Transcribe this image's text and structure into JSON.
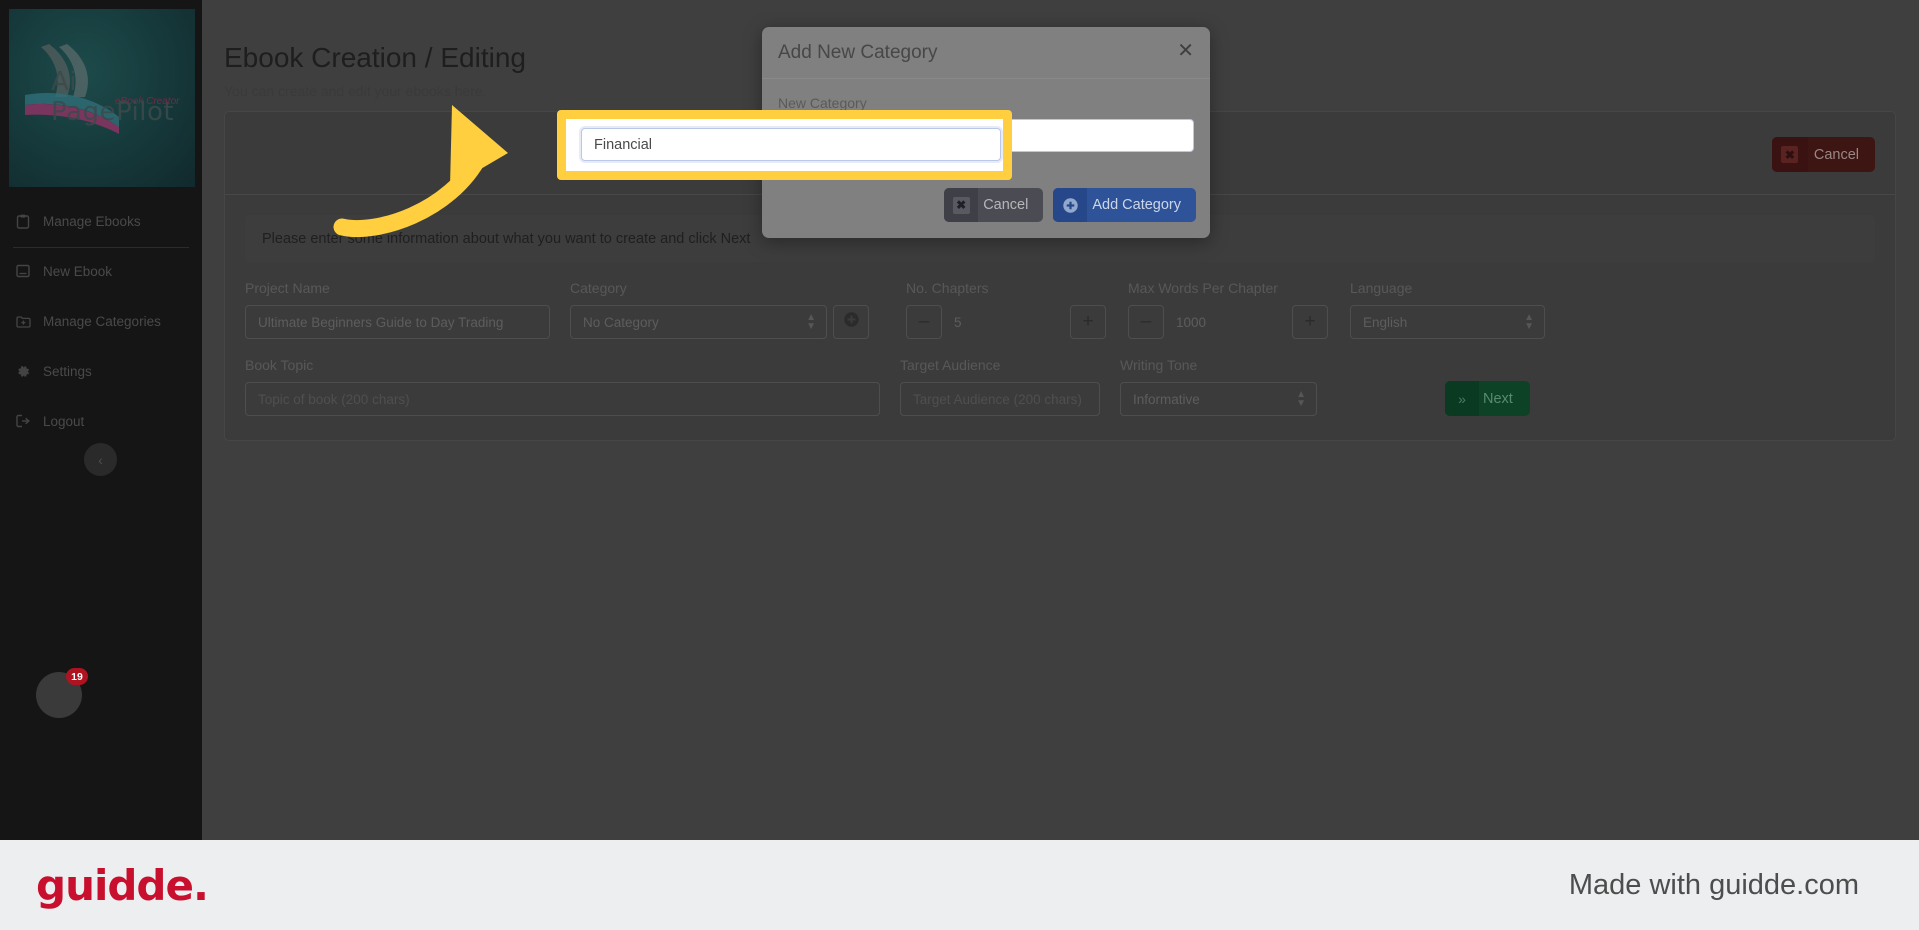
{
  "sidebar": {
    "logo": {
      "name": "Ai PagePilot",
      "tagline": "eBook Creator"
    },
    "items": [
      {
        "label": "Manage Ebooks",
        "icon": "clipboard-icon"
      },
      {
        "label": "New Ebook",
        "icon": "book-icon"
      },
      {
        "label": "Manage Categories",
        "icon": "folder-plus-icon"
      },
      {
        "label": "Settings",
        "icon": "gear-icon"
      },
      {
        "label": "Logout",
        "icon": "logout-icon"
      }
    ],
    "collapse_icon": "chevron-left-icon",
    "avatar_badge": "19"
  },
  "header": {
    "title": "Ebook Creation / Editing",
    "subtitle": "You can create and edit your ebooks here."
  },
  "panel": {
    "cancel_label": "Cancel",
    "cancel_icon": "x-icon",
    "notice": "Please enter some information about what you want to create and click Next",
    "fields": {
      "project_name": {
        "label": "Project Name",
        "value": "Ultimate Beginners Guide to Day Trading"
      },
      "category": {
        "label": "Category",
        "value": "No Category",
        "add_icon": "plus-circle-icon"
      },
      "chapters": {
        "label": "No. Chapters",
        "value": "5",
        "minus": "–",
        "plus": "+"
      },
      "max_words": {
        "label": "Max Words Per Chapter",
        "value": "1000",
        "minus": "–",
        "plus": "+"
      },
      "language": {
        "label": "Language",
        "value": "English"
      },
      "book_topic": {
        "label": "Book Topic",
        "placeholder": "Topic of book (200 chars)"
      },
      "target_audience": {
        "label": "Target Audience",
        "placeholder": "Target Audience (200 chars)"
      },
      "writing_tone": {
        "label": "Writing Tone",
        "value": "Informative"
      }
    },
    "next_label": "Next",
    "next_icon": "double-chevron-right-icon"
  },
  "modal": {
    "title": "Add New Category",
    "close_icon": "close-icon",
    "field_label": "New Category",
    "field_value": "Financial",
    "cancel_label": "Cancel",
    "cancel_icon": "x-icon",
    "add_label": "Add Category",
    "add_icon": "plus-circle-icon"
  },
  "highlight": {
    "input_value": "Financial",
    "border_color": "#ffcf3f",
    "arrow_color": "#ffcf3f"
  },
  "footer": {
    "logo": "guidde.",
    "made_with": "Made with guidde.com",
    "logo_color": "#c8102e"
  }
}
